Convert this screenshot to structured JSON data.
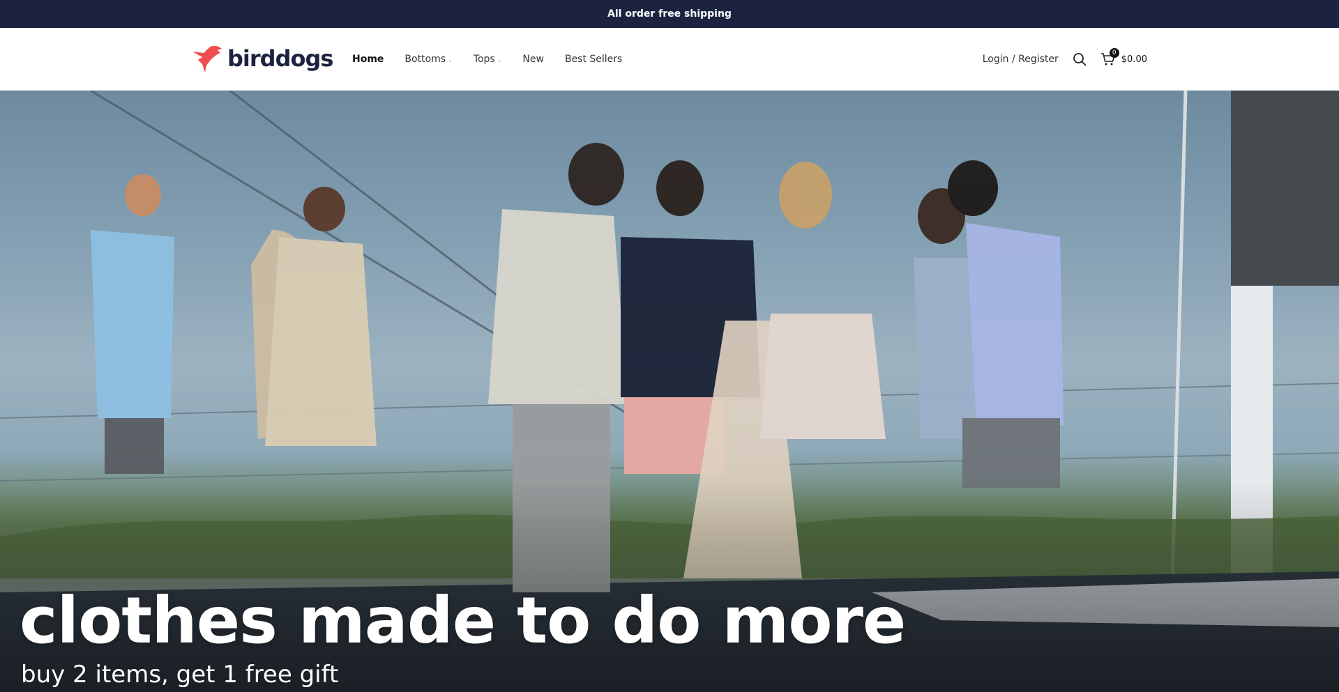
{
  "announcement": {
    "text": "All order free shipping"
  },
  "brand": {
    "name": "birddogs",
    "logo_icon": "bird-icon",
    "accent": "#f04e4e",
    "navy": "#1b2340"
  },
  "nav": {
    "items": [
      {
        "label": "Home",
        "active": true,
        "dropdown": false
      },
      {
        "label": "Bottoms",
        "active": false,
        "dropdown": true
      },
      {
        "label": "Tops",
        "active": false,
        "dropdown": true
      },
      {
        "label": "New",
        "active": false,
        "dropdown": false
      },
      {
        "label": "Best Sellers",
        "active": false,
        "dropdown": false
      }
    ]
  },
  "account": {
    "login_label": "Login / Register"
  },
  "cart": {
    "count": "0",
    "total": "$0.00"
  },
  "hero": {
    "title": "clothes made to do more",
    "subtitle": "buy 2 items, get 1 free gift"
  }
}
